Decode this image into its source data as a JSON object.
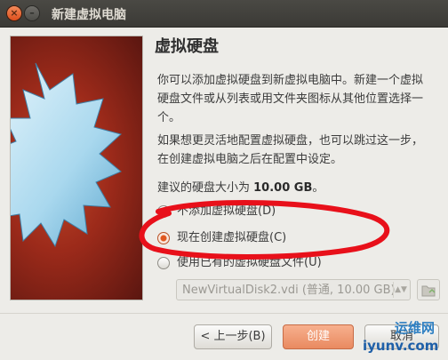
{
  "window": {
    "title": "新建虚拟电脑",
    "close_glyph": "×",
    "min_glyph": "–"
  },
  "page": {
    "heading": "虚拟硬盘",
    "para1": "你可以添加虚拟硬盘到新虚拟电脑中。新建一个虚拟硬盘文件或从列表或用文件夹图标从其他位置选择一个。",
    "para2": "如果想更灵活地配置虚拟硬盘，也可以跳过这一步，在创建虚拟电脑之后在配置中设定。",
    "recommended_prefix": "建议的硬盘大小为 ",
    "recommended_value": "10.00 GB",
    "recommended_suffix": "。"
  },
  "options": [
    {
      "label": "不添加虚拟硬盘(D)",
      "selected": false
    },
    {
      "label": "现在创建虚拟硬盘(C)",
      "selected": true
    },
    {
      "label": "使用已有的虚拟硬盘文件(U)",
      "selected": false
    }
  ],
  "existing_disk": {
    "value": "NewVirtualDisk2.vdi (普通, 10.00 GB)"
  },
  "buttons": {
    "back": "< 上一步(B)",
    "create": "创建",
    "cancel": "取消"
  },
  "watermark": {
    "line1": "运维网",
    "line2": "iyunv.com"
  },
  "colors": {
    "accent": "#e0581f",
    "annotation": "#e8101a"
  }
}
